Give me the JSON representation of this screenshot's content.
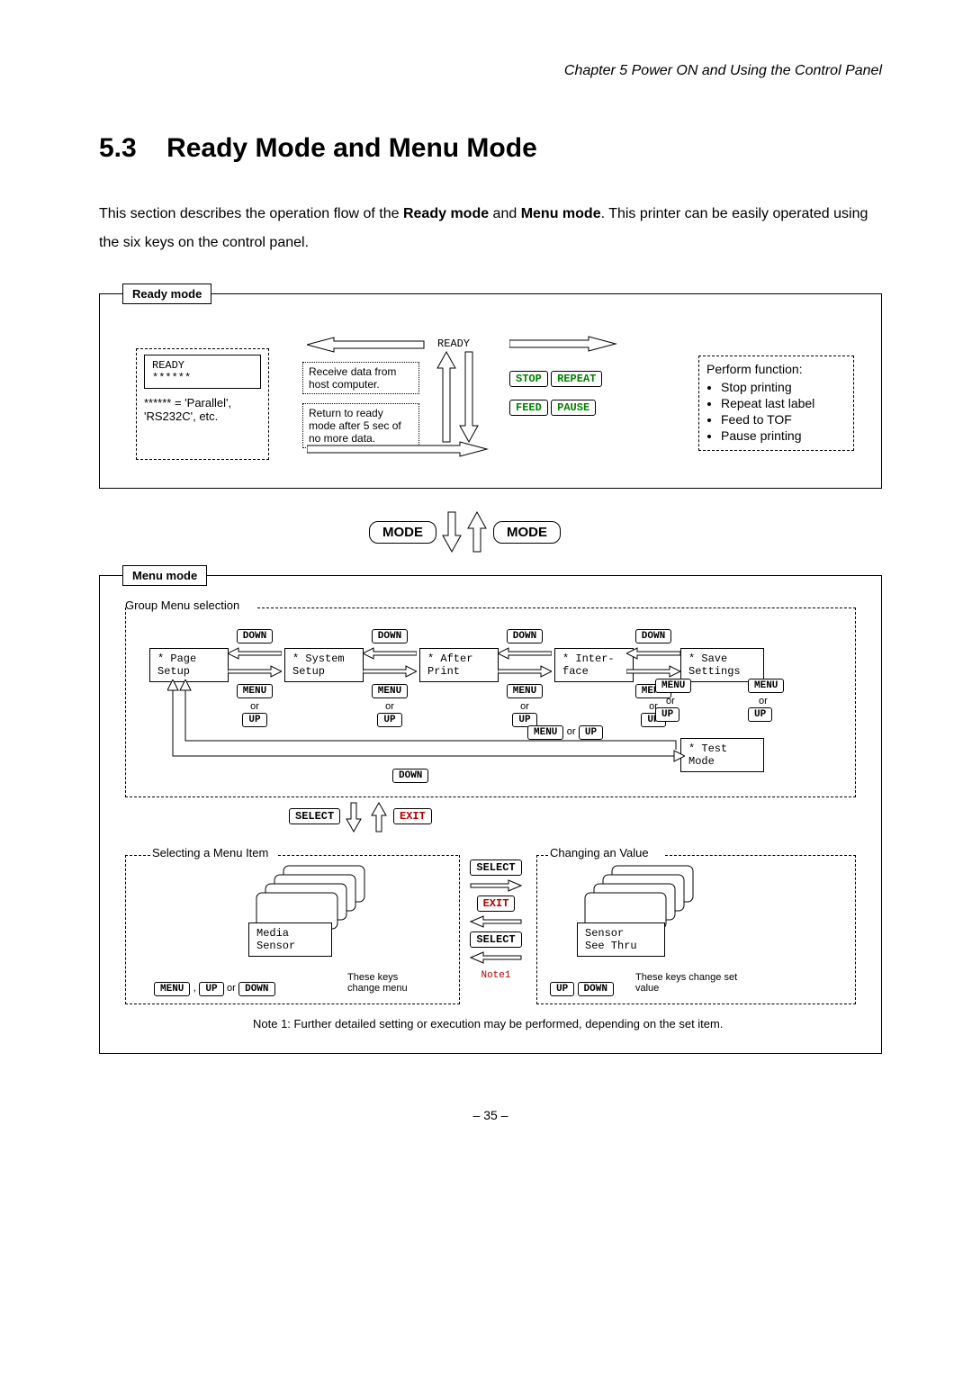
{
  "chapter_header": "Chapter 5   Power ON and Using the Control Panel",
  "section_number": "5.3",
  "section_title": "Ready Mode and Menu Mode",
  "intro_before_bold1": "This section describes the operation flow of the ",
  "intro_bold1": "Ready mode",
  "intro_mid": " and ",
  "intro_bold2": "Menu mode",
  "intro_after": ".  This printer can be easily operated using the six keys on the control panel.",
  "ready_mode": {
    "label": "Ready mode",
    "lcd_line1": "READY",
    "lcd_line2": "******",
    "lcd_note": "****** = 'Parallel', 'RS232C', etc.",
    "ready_caption": "READY",
    "info_box1": "Receive data from host computer.",
    "info_box2": "Return to ready mode after 5 sec of no more data.",
    "func_title": "Perform function:",
    "func_items": [
      "Stop printing",
      "Repeat last label",
      "Feed to TOF",
      "Pause printing"
    ],
    "keys": {
      "stop": "STOP",
      "repeat": "REPEAT",
      "feed": "FEED",
      "pause": "PAUSE"
    }
  },
  "mode_btn": "MODE",
  "menu_mode": {
    "label": "Menu mode",
    "group_sel": "Group Menu selection",
    "nav_down": "DOWN",
    "nav_menu": "MENU",
    "nav_or": "or",
    "nav_up": "UP",
    "menus": {
      "page_setup": "* Page\n  Setup",
      "system_setup": "* System\n  Setup",
      "after_print": "* After\n  Print",
      "interface": "* Inter-\n  face",
      "save_settings": "* Save\n  Settings",
      "test_mode": "* Test\n  Mode"
    },
    "select_btn": "SELECT",
    "exit_btn": "EXIT",
    "sel_menu_label": "Selecting a Menu Item",
    "change_val_label": "Changing an Value",
    "media_sensor_box": "Media\nSensor",
    "sensor_seethru_box": "Sensor\nSee Thru",
    "keys_change_menu": "These keys change menu",
    "keys_change_value": "These keys change set value",
    "note1_marker": "Note1",
    "note1_text": "Note 1: Further detailed setting or execution may be performed, depending on the set item."
  },
  "page_number": "– 35 –"
}
